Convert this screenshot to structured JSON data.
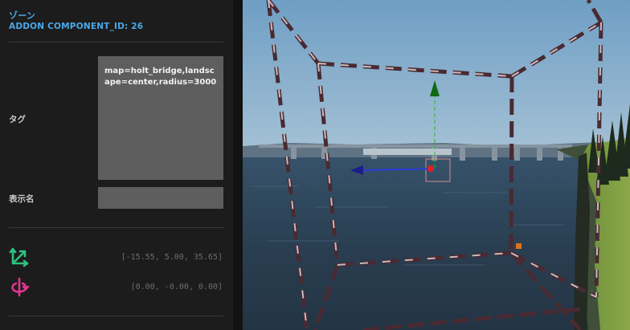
{
  "inspector": {
    "title": "ゾーン",
    "subtitle": "ADDON COMPONENT_ID: 26",
    "tag_label": "タグ",
    "tag_value": "map=holt_bridge,landscape=center,radius=3000",
    "display_name_label": "表示名",
    "display_name_value": "",
    "position": {
      "icon": "move-axes-icon",
      "value": "[-15.55, 5.00, 35.65]"
    },
    "rotation": {
      "icon": "rotate-axis-icon",
      "value": "[0.00, -0.00, 0.00]"
    }
  },
  "colors": {
    "accent": "#4aa8e8",
    "position_icon": "#2ec27e",
    "rotation_icon": "#e0358c",
    "zone_outline": "#4a2a32",
    "gizmo_x": "#1a2bd0",
    "gizmo_y": "#1b8a1b"
  }
}
